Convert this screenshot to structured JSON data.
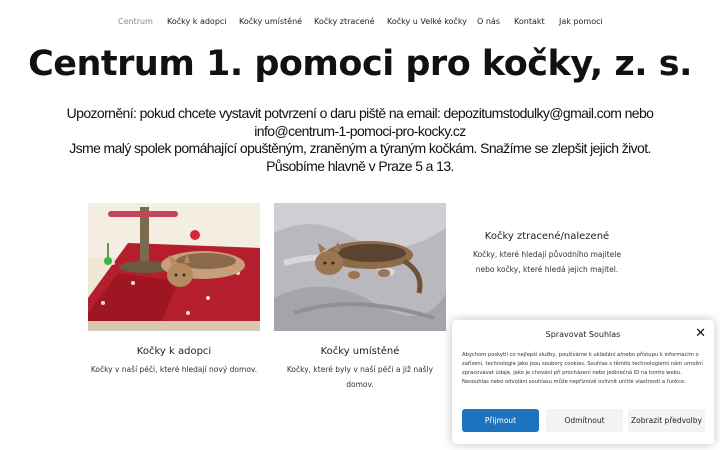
{
  "nav": {
    "items": [
      {
        "label": "Centrum"
      },
      {
        "label": "Kočky k adopci"
      },
      {
        "label": "Kočky umístěné"
      },
      {
        "label": "Kočky ztracené"
      },
      {
        "label": "Kočky u Velké kočky"
      },
      {
        "label": "O nás"
      },
      {
        "label": "Kontakt"
      },
      {
        "label": "Jak pomoci"
      }
    ],
    "active_index": 0
  },
  "page": {
    "title": "Centrum 1. pomoci pro kočky, z. s.",
    "notice_line1": "Upozornění: pokud chcete vystavit potvrzení o daru piště na email: depozitumstodulky@gmail.com nebo",
    "notice_line2": "info@centrum-1-pomoci-pro-kocky.cz",
    "notice_line3": "Jsme malý spolek pomáhající opuštěným, zraněným a týraným kočkám. Snažíme se zlepšit jejich život.",
    "notice_line4": "Působíme hlavně v Praze 5 a 13."
  },
  "cards": [
    {
      "title": "Kočky k adopci",
      "desc_line1": "Kočky v naší péči, které hledají nový domov.",
      "desc_line2": ""
    },
    {
      "title": "Kočky umístěné",
      "desc_line1": "Kočky, které byly v naší péči a již našly",
      "desc_line2": "domov."
    },
    {
      "title": "Kočky ztracené/nalezené",
      "desc_line1": "Kočky, které hledají původního majitele",
      "desc_line2": "nebo kočky, které hledá jejich majitel."
    }
  ],
  "consent": {
    "title": "Spravovat Souhlas",
    "close_symbol": "✕",
    "text": "Abychom poskytli co nejlepší služby, používáme k ukládání a/nebo přístupu k informacím o zařízení, technologie jako jsou soubory cookies. Souhlas s těmito technologiemi nám umožní zpracovávat údaje, jako je chování při procházení nebo jedinečná ID na tomto webu. Nesouhlas nebo odvolání souhlasu může nepříznivě ovlivnit určité vlastnosti a funkce.",
    "accept_label": "Přijmout",
    "deny_label": "Odmítnout",
    "prefs_label": "Zobrazit předvolby",
    "accent_color": "#1e73be"
  }
}
